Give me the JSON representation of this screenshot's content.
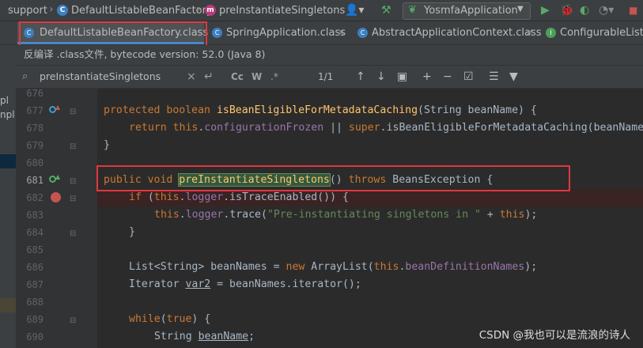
{
  "breadcrumb": {
    "items": [
      "support",
      "DefaultListableBeanFactory",
      "preInstantiateSingletons"
    ]
  },
  "toolbar": {
    "run_config": "YosmfaApplication"
  },
  "tabs": [
    {
      "label": "DefaultListableBeanFactory.class"
    },
    {
      "label": "SpringApplication.class"
    },
    {
      "label": "AbstractApplicationContext.class"
    },
    {
      "label": "ConfigurableListab"
    }
  ],
  "info_banner": "反编译 .class文件, bytecode version: 52.0 (Java 8)",
  "search": {
    "query": "preInstantiateSingletons",
    "match_count": "1/1",
    "case_toggle": "Cc",
    "word_toggle": "W",
    "regex_toggle": ".*"
  },
  "side_panel": {
    "fragments": [
      "pl",
      "npl"
    ]
  },
  "gutter": {
    "line_numbers": [
      "676",
      "677",
      "678",
      "679",
      "680",
      "681",
      "682",
      "683",
      "684",
      "685",
      "686",
      "687",
      "688",
      "689",
      "690"
    ]
  },
  "code": {
    "l677_a": "protected ",
    "l677_b": "boolean ",
    "l677_c": "isBeanEligibleForMetadataCaching",
    "l677_d": "(String beanName) {",
    "l678_a": "return ",
    "l678_b": "this",
    "l678_c": ".",
    "l678_d": "configurationFrozen",
    "l678_e": " || ",
    "l678_f": "super",
    "l678_g": ".isBeanEligibleForMetadataCaching(beanName",
    "l679": "}",
    "l681_a": "public ",
    "l681_b": "void ",
    "l681_c": "preInstantiateSingletons",
    "l681_d": "() ",
    "l681_e": "throws ",
    "l681_f": "BeansException {",
    "l682_a": "if ",
    "l682_b": "(",
    "l682_c": "this",
    "l682_d": ".",
    "l682_e": "logger",
    "l682_f": ".isTraceEnabled()) {",
    "l683_a": "this",
    "l683_b": ".",
    "l683_c": "logger",
    "l683_d": ".trace(",
    "l683_e": "\"Pre-instantiating singletons in \"",
    "l683_f": " + ",
    "l683_g": "this",
    "l683_h": ");",
    "l684": "}",
    "l686_a": "List<String> beanNames = ",
    "l686_b": "new ",
    "l686_c": "ArrayList(",
    "l686_d": "this",
    "l686_e": ".",
    "l686_f": "beanDefinitionNames",
    "l686_g": ");",
    "l687_a": "Iterator ",
    "l687_b": "var2",
    "l687_c": " = beanNames.iterator();",
    "l689_a": "while",
    "l689_b": "(",
    "l689_c": "true",
    "l689_d": ") {",
    "l690_a": "String ",
    "l690_b": "beanName",
    "l690_c": ";"
  },
  "watermark": "CSDN @我也可以是流浪的诗人",
  "colors": {
    "keyword": "#cc7832",
    "method": "#ffc66d",
    "field": "#9876aa",
    "string": "#6a8759",
    "highlight_box": "#e0383e",
    "breakpoint": "#c75450"
  }
}
